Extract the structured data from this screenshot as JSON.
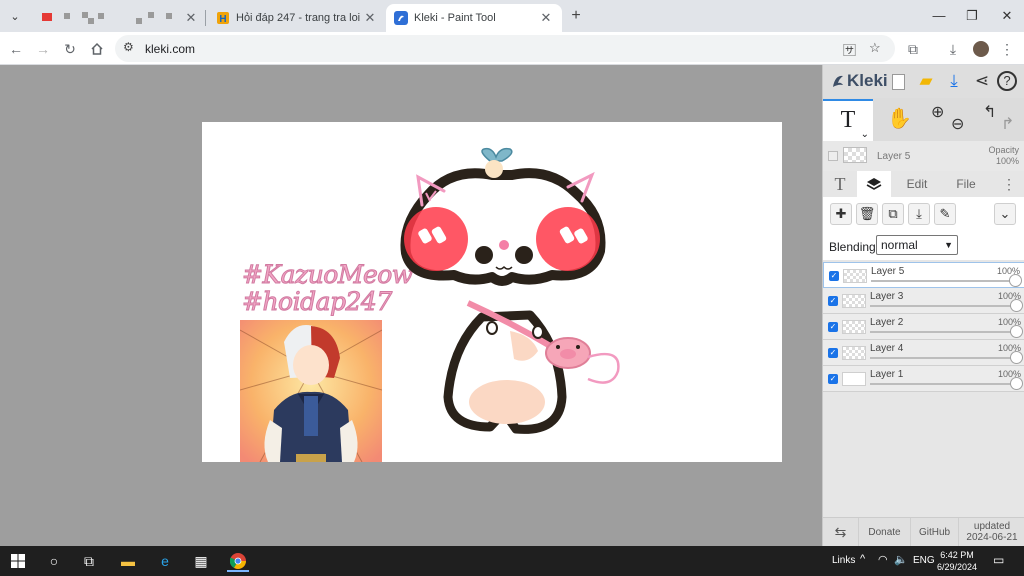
{
  "browser": {
    "tabs": [
      {
        "title": "Hỏi đáp 247 - trang tra loi",
        "active": false
      },
      {
        "title": "Kleki - Paint Tool",
        "active": true
      }
    ],
    "url": "kleki.com"
  },
  "kleki": {
    "logo": "Kleki",
    "current_layer": {
      "name": "Layer 5",
      "opacity_label": "Opacity",
      "opacity_value": "100%"
    },
    "tabs": {
      "edit": "Edit",
      "file": "File"
    },
    "blending": {
      "label": "Blending",
      "value": "normal"
    },
    "layers": [
      {
        "name": "Layer 5",
        "opacity": "100%",
        "selected": true
      },
      {
        "name": "Layer 3",
        "opacity": "100%",
        "selected": false
      },
      {
        "name": "Layer 2",
        "opacity": "100%",
        "selected": false
      },
      {
        "name": "Layer 4",
        "opacity": "100%",
        "selected": false
      },
      {
        "name": "Layer 1",
        "opacity": "100%",
        "selected": false
      }
    ],
    "footer": {
      "donate": "Donate",
      "github": "GitHub",
      "updated_label": "updated",
      "updated_date": "2024-06-21"
    }
  },
  "canvas_text": {
    "line1": "#KazuoMeow",
    "line2": "#hoidap247"
  },
  "taskbar": {
    "links": "Links",
    "lang": "ENG",
    "time": "6:42 PM",
    "date": "6/29/2024"
  }
}
